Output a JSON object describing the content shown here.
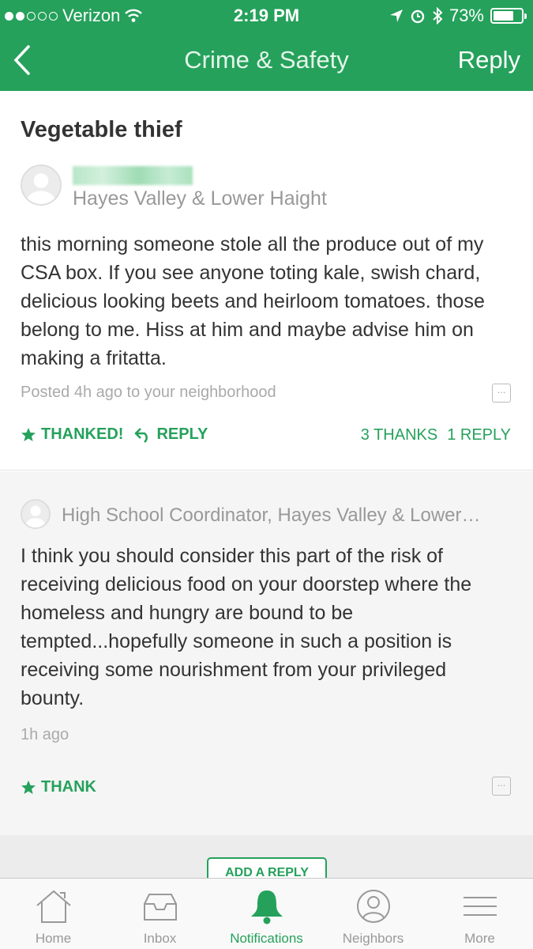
{
  "status_bar": {
    "carrier": "Verizon",
    "time": "2:19 PM",
    "battery": "73%",
    "battery_level": 0.73
  },
  "nav": {
    "title": "Crime & Safety",
    "reply_label": "Reply"
  },
  "post": {
    "title": "Vegetable thief",
    "neighborhood": "Hayes Valley & Lower Haight",
    "body": "this morning someone stole all the produce out of my CSA box. If you see anyone toting kale, swish chard, delicious looking beets and heirloom tomatoes. those belong to me. Hiss at him and maybe advise him on making a fritatta.",
    "meta": "Posted 4h ago to your neighborhood",
    "thanked_label": "THANKED!",
    "reply_label": "REPLY",
    "thanks_count": "3 THANKS",
    "reply_count": "1 REPLY"
  },
  "reply": {
    "byline": "High School Coordinator, Hayes Valley & Lower…",
    "body": "I think you should consider this part of the risk of receiving delicious food on your doorstep where the homeless and hungry are bound to be tempted...hopefully someone in such a position is receiving some nourishment from your privileged bounty.",
    "time": "1h ago",
    "thank_label": "THANK"
  },
  "add_reply_label": "ADD A REPLY",
  "tabs": [
    {
      "label": "Home",
      "icon": "home-icon"
    },
    {
      "label": "Inbox",
      "icon": "inbox-icon"
    },
    {
      "label": "Notifications",
      "icon": "bell-icon",
      "active": true
    },
    {
      "label": "Neighbors",
      "icon": "neighbors-icon"
    },
    {
      "label": "More",
      "icon": "menu-icon"
    }
  ],
  "colors": {
    "brand_green": "#25a15b",
    "reply_bg": "#f5f5f5"
  }
}
